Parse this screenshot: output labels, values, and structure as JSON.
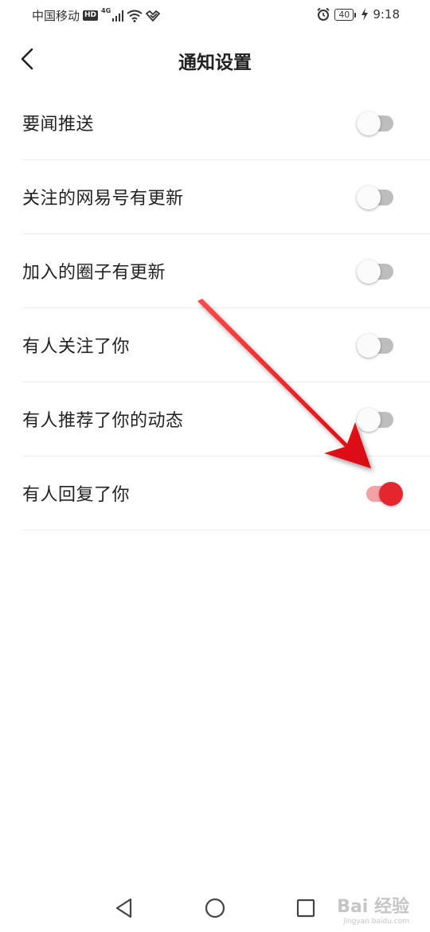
{
  "status_bar": {
    "carrier": "中国移动",
    "hd_badge": "HD",
    "network": "4G",
    "battery": "40",
    "time": "9:18",
    "icons": [
      "signal-icon",
      "wifi-icon",
      "alarm-icon",
      "charging-icon"
    ]
  },
  "header": {
    "title": "通知设置",
    "back_icon": "chevron-left-icon"
  },
  "settings": [
    {
      "label": "要闻推送",
      "enabled": false
    },
    {
      "label": "关注的网易号有更新",
      "enabled": false
    },
    {
      "label": "加入的圈子有更新",
      "enabled": false
    },
    {
      "label": "有人关注了你",
      "enabled": false
    },
    {
      "label": "有人推荐了你的动态",
      "enabled": false
    },
    {
      "label": "有人回复了你",
      "enabled": true
    }
  ],
  "colors": {
    "accent": "#e5262e",
    "toggle_on_track": "#f3a1a4",
    "toggle_off_track": "#bdbdbd",
    "divider": "#ececec",
    "annotation_arrow": "#e8141b"
  },
  "nav_bar": {
    "icons": [
      "back-triangle-icon",
      "home-circle-icon",
      "recents-square-icon"
    ]
  },
  "watermark": {
    "text": "Bai 经验",
    "sub": "jingyan.baidu.com"
  }
}
